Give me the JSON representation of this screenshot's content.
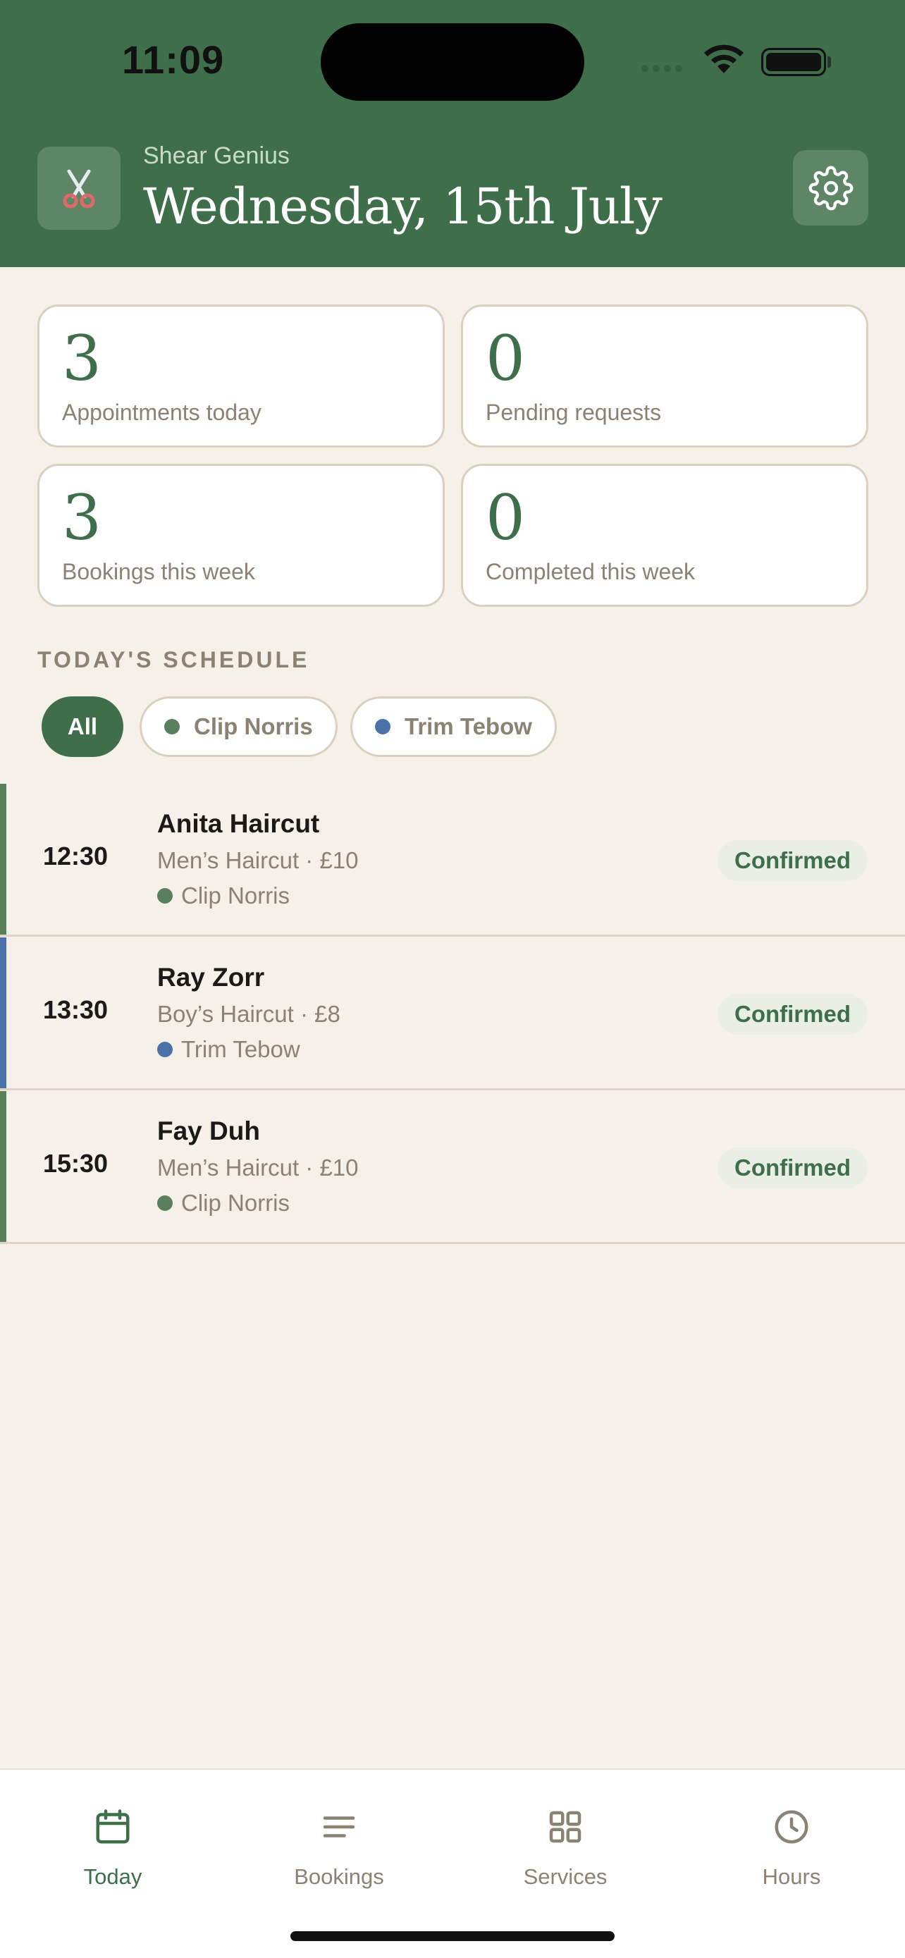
{
  "status_bar": {
    "time": "11:09"
  },
  "header": {
    "shop_name": "Shear Genius",
    "date_title": "Wednesday, 15th July",
    "logo_icon": "scissors-icon",
    "settings_icon": "gear-icon"
  },
  "stats": [
    {
      "value": "3",
      "label": "Appointments today"
    },
    {
      "value": "0",
      "label": "Pending requests"
    },
    {
      "value": "3",
      "label": "Bookings this week"
    },
    {
      "value": "0",
      "label": "Completed this week"
    }
  ],
  "schedule": {
    "title": "TODAY'S SCHEDULE",
    "filters": [
      {
        "label": "All",
        "active": true
      },
      {
        "label": "Clip Norris",
        "color": "#5a7f5d"
      },
      {
        "label": "Trim Tebow",
        "color": "#4a72a8"
      }
    ],
    "appointments": [
      {
        "time": "12:30",
        "name": "Anita Haircut",
        "service": "Men’s Haircut · £10",
        "staff": "Clip Norris",
        "staff_color": "#5a7f5d",
        "status": "Confirmed"
      },
      {
        "time": "13:30",
        "name": "Ray Zorr",
        "service": "Boy’s Haircut · £8",
        "staff": "Trim Tebow",
        "staff_color": "#4a72a8",
        "status": "Confirmed"
      },
      {
        "time": "15:30",
        "name": "Fay Duh",
        "service": "Men’s Haircut · £10",
        "staff": "Clip Norris",
        "staff_color": "#5a7f5d",
        "status": "Confirmed"
      }
    ]
  },
  "tabbar": {
    "tabs": [
      {
        "label": "Today",
        "icon": "calendar-icon",
        "active": true
      },
      {
        "label": "Bookings",
        "icon": "list-icon"
      },
      {
        "label": "Services",
        "icon": "grid-icon"
      },
      {
        "label": "Hours",
        "icon": "clock-icon"
      }
    ]
  },
  "colors": {
    "brand_green": "#3f6f4a",
    "background": "#f5f1e9",
    "muted_text": "#8b8274"
  }
}
